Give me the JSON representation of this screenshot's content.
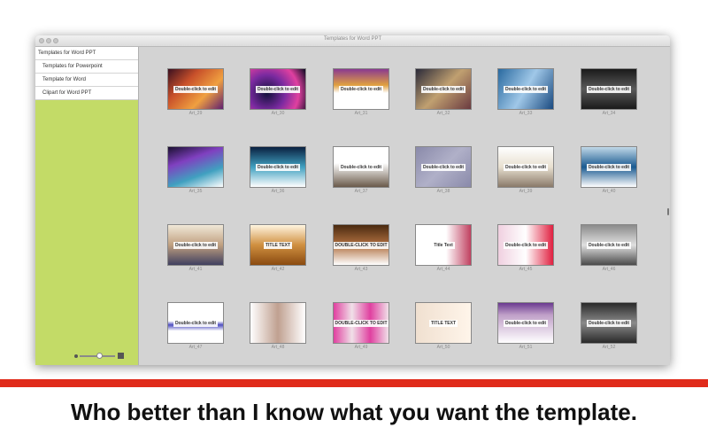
{
  "window": {
    "title": "Templates for Word PPT"
  },
  "sidebar": {
    "items": [
      {
        "label": "Templates for Word PPT"
      },
      {
        "label": "Templates for Powerpoint"
      },
      {
        "label": "Template for Word"
      },
      {
        "label": "Clipart for Word PPT"
      }
    ]
  },
  "gallery": {
    "items": [
      {
        "label": "Art_29",
        "caption": "Double-click to edit",
        "bg": "linear-gradient(135deg,#3a1020,#c8502a,#f0a040,#602070)"
      },
      {
        "label": "Art_30",
        "caption": "Double-click to edit",
        "bg": "radial-gradient(circle at 30% 60%,#10103a,#7a2aa0 40%,#e040a0 70%,#0a0a20)"
      },
      {
        "label": "Art_31",
        "caption": "Double-click to edit",
        "bg": "linear-gradient(180deg,#8a3a90,#e0a040 40%,#ffffff 60%)"
      },
      {
        "label": "Art_32",
        "caption": "Double-click to edit",
        "bg": "linear-gradient(135deg,#2a2a3a,#c0a070,#6a3a40)"
      },
      {
        "label": "Art_33",
        "caption": "Double-click to edit",
        "bg": "linear-gradient(120deg,#2a6aa0,#a0c8e8,#1a4a80)"
      },
      {
        "label": "Art_34",
        "caption": "Double-click to edit",
        "bg": "linear-gradient(180deg,#1a1a1a,#5a5a5a,#1a1a1a)"
      },
      {
        "label": "Art_35",
        "caption": "",
        "bg": "linear-gradient(160deg,#1a1030,#8040c0,#40a0c0,#ffffff)"
      },
      {
        "label": "Art_36",
        "caption": "Double-click to edit",
        "bg": "linear-gradient(180deg,#0a2040,#40a0c0,#ffffff)"
      },
      {
        "label": "Art_37",
        "caption": "Double-click to edit",
        "bg": "linear-gradient(180deg,#ffffff 40%,#6a5a4a)"
      },
      {
        "label": "Art_38",
        "caption": "Double-click to edit",
        "bg": "linear-gradient(135deg,#8a8aaa,#b0b0c8,#8a8aaa)"
      },
      {
        "label": "Art_39",
        "caption": "Double-click to edit",
        "bg": "linear-gradient(180deg,#ffffff,#e8e0d0,#8a7a6a)"
      },
      {
        "label": "Art_40",
        "caption": "Double-click to edit",
        "bg": "linear-gradient(180deg,#c0d8e8,#1a5a90,#ffffff)"
      },
      {
        "label": "Art_41",
        "caption": "Double-click to edit",
        "bg": "linear-gradient(180deg,#f0e8d8,#c0a080,#404060)"
      },
      {
        "label": "Art_42",
        "caption": "TITLE TEXT",
        "bg": "linear-gradient(180deg,#fff5e0,#d09040,#8a4a10)"
      },
      {
        "label": "Art_43",
        "caption": "DOUBLE-CLICK TO EDIT",
        "bg": "linear-gradient(180deg,#4a2a10,#b07040,#ffffff)"
      },
      {
        "label": "Art_44",
        "caption": "Title Text",
        "bg": "linear-gradient(90deg,#ffffff 55%,#c04060)"
      },
      {
        "label": "Art_45",
        "caption": "Double-click to edit",
        "bg": "linear-gradient(90deg,#f0d0e0,#ffffff 50%,#e02040)"
      },
      {
        "label": "Art_46",
        "caption": "Double-click to edit",
        "bg": "linear-gradient(180deg,#8a8a8a,#e0e0e0,#4a4a4a)"
      },
      {
        "label": "Art_47",
        "caption": "Double-click to edit",
        "bg": "linear-gradient(180deg,#ffffff 45%,#5050c0 55%,#ffffff 70%)"
      },
      {
        "label": "Art_48",
        "caption": "",
        "bg": "linear-gradient(90deg,#ffffff,#c0a090 50%,#ffffff)"
      },
      {
        "label": "Art_49",
        "caption": "DOUBLE-CLICK TO EDIT",
        "bg": "linear-gradient(90deg,#e040a0,#f0e0e8,#e040a0,#f0e0e8)"
      },
      {
        "label": "Art_50",
        "caption": "TITLE TEXT",
        "bg": "linear-gradient(90deg,#f0e0d0,#fff5ea)"
      },
      {
        "label": "Art_51",
        "caption": "Double-click to edit",
        "bg": "linear-gradient(180deg,#6a3a90,#c0a0c8 30%,#ffffff)"
      },
      {
        "label": "Art_52",
        "caption": "Double-click to edit",
        "bg": "linear-gradient(180deg,#2a2a2a,#8a8a8a,#2a2a2a)"
      }
    ]
  },
  "tagline": "Who better than I know what you want the template."
}
